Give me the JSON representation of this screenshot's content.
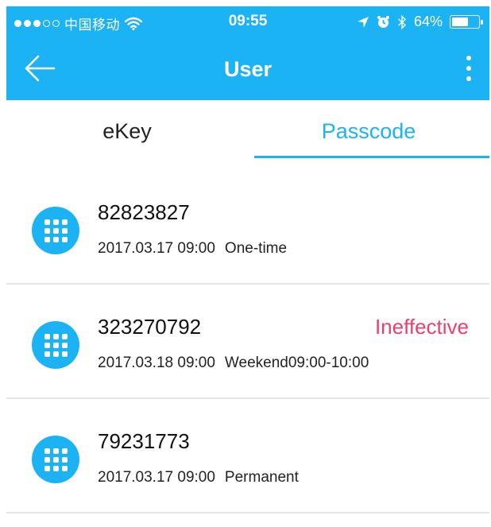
{
  "status_bar": {
    "carrier": "中国移动",
    "time": "09:55",
    "battery": "64%",
    "battery_level": 0.64,
    "signal_bars_filled": 3,
    "signal_bars_total": 5
  },
  "header": {
    "title": "User",
    "color": "#1cb3f4"
  },
  "tabs": [
    {
      "label": "eKey",
      "active": false
    },
    {
      "label": "Passcode",
      "active": true
    }
  ],
  "passcodes": [
    {
      "code": "82823827",
      "date": "2017.03.17 09:00",
      "type": "One-time",
      "status": ""
    },
    {
      "code": "323270792",
      "date": "2017.03.18 09:00",
      "type": "Weekend09:00-10:00",
      "status": "Ineffective"
    },
    {
      "code": "79231773",
      "date": "2017.03.17 09:00",
      "type": "Permanent",
      "status": ""
    }
  ],
  "colors": {
    "accent": "#1cb3f4",
    "status_warning": "#ee3f6b"
  }
}
